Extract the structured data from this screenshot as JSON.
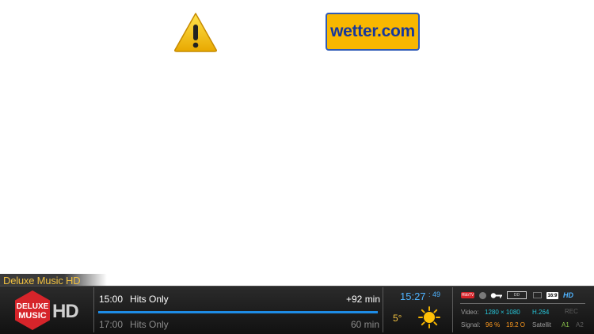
{
  "top": {
    "logo_text": "wetter.com"
  },
  "channel": {
    "name": "Deluxe Music HD",
    "logo_line1": "DELUXE",
    "logo_line2": "MUSIC",
    "logo_hd": "HD"
  },
  "epg": {
    "current": {
      "time": "15:00",
      "title": "Hits Only",
      "remaining": "+92 min"
    },
    "next": {
      "time": "17:00",
      "title": "Hits Only",
      "duration": "60 min"
    },
    "progress_percent": 100
  },
  "clock": {
    "time": "15:27",
    "seconds": "49"
  },
  "weather": {
    "temperature": "5°",
    "icon": "sun-icon"
  },
  "status": {
    "badges": [
      "hbbtv-badge",
      "ci-icon",
      "key-icon",
      "dolby-digital-badge",
      "subtitle-icon",
      "aspect-badge",
      "hd-badge",
      "rec-label"
    ],
    "hbbtv": "HbbTV",
    "aspect": "16:9",
    "hd": "HD",
    "rec": "REC",
    "video_label": "Video:",
    "resolution": "1280 × 1080",
    "codec": "H.264",
    "signal_label": "Signal:",
    "signal_strength": "96 %",
    "signal_quality": "19.2 O",
    "source": "Satellit",
    "a1": "A1",
    "a2": "A2"
  },
  "colors": {
    "accent_blue": "#4fb3ff",
    "progress": "#1e8ce6",
    "channel_red": "#d6242a",
    "wetter_yellow": "#f8b700"
  }
}
